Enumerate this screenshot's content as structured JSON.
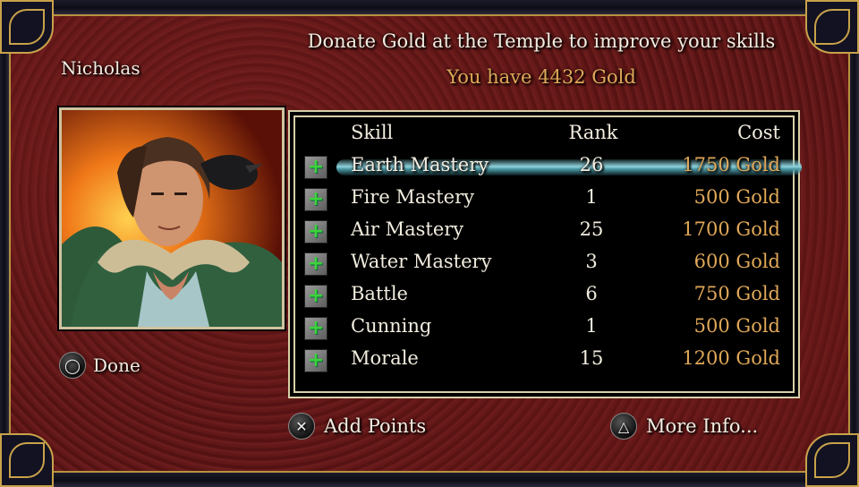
{
  "header": {
    "instruction": "Donate Gold at the Temple to improve your skills",
    "gold_line": "You have 4432 Gold"
  },
  "hero": {
    "name": "Nicholas"
  },
  "table": {
    "columns": [
      "Skill",
      "Rank",
      "Cost"
    ],
    "rows": [
      {
        "skill": "Earth Mastery",
        "rank": "26",
        "cost": "1750 Gold",
        "selected": true
      },
      {
        "skill": "Fire Mastery",
        "rank": "1",
        "cost": "500 Gold"
      },
      {
        "skill": "Air Mastery",
        "rank": "25",
        "cost": "1700 Gold"
      },
      {
        "skill": "Water Mastery",
        "rank": "3",
        "cost": "600 Gold"
      },
      {
        "skill": "Battle",
        "rank": "6",
        "cost": "750 Gold"
      },
      {
        "skill": "Cunning",
        "rank": "1",
        "cost": "500 Gold"
      },
      {
        "skill": "Morale",
        "rank": "15",
        "cost": "1200 Gold"
      }
    ]
  },
  "buttons": {
    "done": {
      "label": "Done",
      "icon": "circle-button-icon"
    },
    "add_points": {
      "label": "Add Points",
      "icon": "cross-button-icon"
    },
    "more_info": {
      "label": "More Info...",
      "icon": "triangle-button-icon"
    }
  },
  "colors": {
    "gold_text": "#e0a858",
    "plus_green": "#3cd23c",
    "highlight": "#8fd2dc"
  }
}
